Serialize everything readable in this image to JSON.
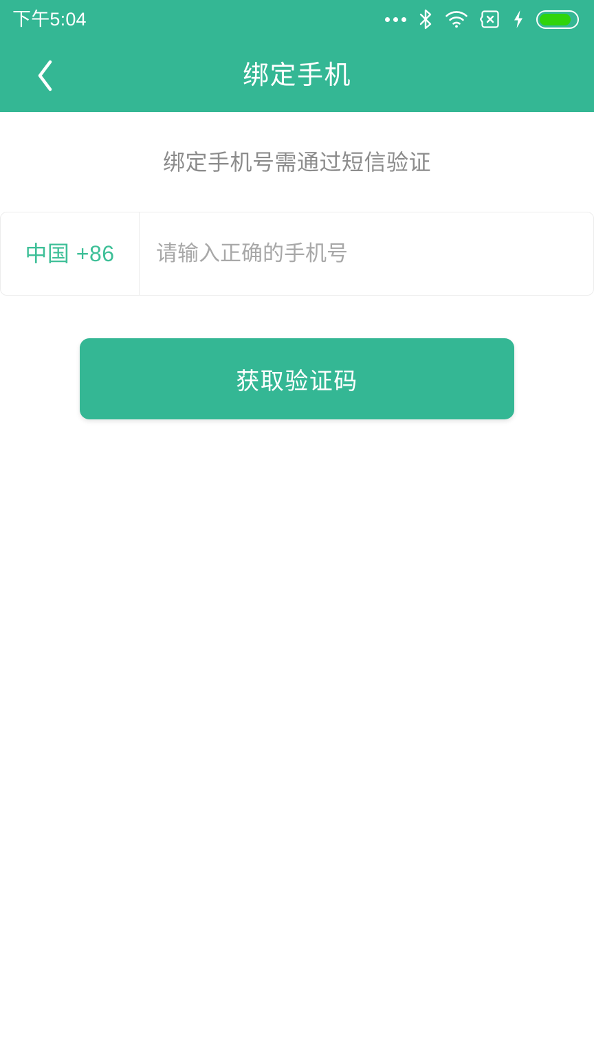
{
  "status_bar": {
    "time": "下午5:04",
    "icons": [
      "more-icon",
      "bluetooth-icon",
      "wifi-icon",
      "sim-missing-icon",
      "charging-bolt-icon",
      "battery-icon"
    ],
    "battery_level_percent": 86
  },
  "app_bar": {
    "back_label": "‹",
    "title": "绑定手机"
  },
  "main": {
    "hint": "绑定手机号需通过短信验证",
    "country": {
      "label": "中国 +86"
    },
    "phone": {
      "value": "",
      "placeholder": "请输入正确的手机号"
    },
    "primary_button": "获取验证码"
  },
  "colors": {
    "brand": "#34b794",
    "brand_text": "#3dbf97",
    "hint_text": "#8c8c8c",
    "placeholder": "#a8a8a8",
    "battery_fill": "#2fd40b",
    "border": "#ececec",
    "page_bg": "#ffffff"
  }
}
